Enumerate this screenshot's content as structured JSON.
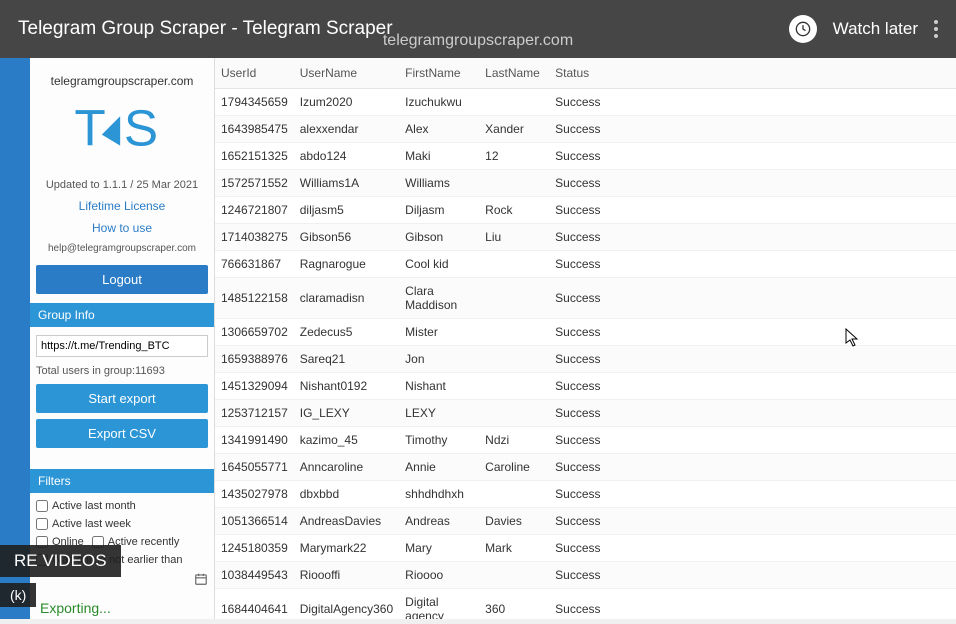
{
  "yt": {
    "title": "Telegram Group Scraper - Telegram Scraper",
    "subtitle": "telegramgroupscraper.com",
    "watch_later": "Watch later",
    "re_videos": "RE VIDEOS",
    "k": "(k)"
  },
  "sidebar": {
    "brand": "telegramgroupscraper.com",
    "updated": "Updated to 1.1.1 / 25 Mar 2021",
    "lifetime": "Lifetime License",
    "howto": "How to use",
    "help_email": "help@telegramgroupscraper.com",
    "logout": "Logout",
    "group_info_label": "Group Info",
    "group_url": "https://t.me/Trending_BTC",
    "total_users": "Total users in group:11693",
    "start_export": "Start export",
    "export_csv": "Export CSV",
    "filters_label": "Filters",
    "f_month": "Active last month",
    "f_week": "Active last week",
    "f_online": "Online",
    "f_recent": "Active recently",
    "f_earlier": "Was online not earlier than",
    "exporting": "Exporting..."
  },
  "table": {
    "headers": [
      "UserId",
      "UserName",
      "FirstName",
      "LastName",
      "Status"
    ],
    "rows": [
      [
        "1794345659",
        "Izum2020",
        "Izuchukwu",
        "",
        "Success"
      ],
      [
        "1643985475",
        "alexxendar",
        "Alex",
        "Xander",
        "Success"
      ],
      [
        "1652151325",
        "abdo124",
        "Maki",
        "12",
        "Success"
      ],
      [
        "1572571552",
        "Williams1A",
        "Williams",
        "",
        "Success"
      ],
      [
        "1246721807",
        "diljasm5",
        "Diljasm",
        "Rock",
        "Success"
      ],
      [
        "1714038275",
        "Gibson56",
        "Gibson",
        "Liu",
        "Success"
      ],
      [
        "766631867",
        "Ragnarogue",
        "Cool kid",
        "",
        "Success"
      ],
      [
        "1485122158",
        "claramadisn",
        "Clara Maddison",
        "",
        "Success"
      ],
      [
        "1306659702",
        "Zedecus5",
        "Mister",
        "",
        "Success"
      ],
      [
        "1659388976",
        "Sareq21",
        "Jon",
        "",
        "Success"
      ],
      [
        "1451329094",
        "Nishant0192",
        "Nishant",
        "",
        "Success"
      ],
      [
        "1253712157",
        "IG_LEXY",
        "LEXY",
        "",
        "Success"
      ],
      [
        "1341991490",
        "kazimo_45",
        "Timothy",
        "Ndzi",
        "Success"
      ],
      [
        "1645055771",
        "Anncaroline",
        "Annie",
        "Caroline",
        "Success"
      ],
      [
        "1435027978",
        "dbxbbd",
        "shhdhdhxh",
        "",
        "Success"
      ],
      [
        "1051366514",
        "AndreasDavies",
        "Andreas",
        "Davies",
        "Success"
      ],
      [
        "1245180359",
        "Marymark22",
        "Mary",
        "Mark",
        "Success"
      ],
      [
        "1038449543",
        "Rioooffi",
        "Rioooo",
        "",
        "Success"
      ],
      [
        "1684404641",
        "DigitalAgency360",
        "Digital agency",
        "360",
        "Success"
      ]
    ]
  }
}
